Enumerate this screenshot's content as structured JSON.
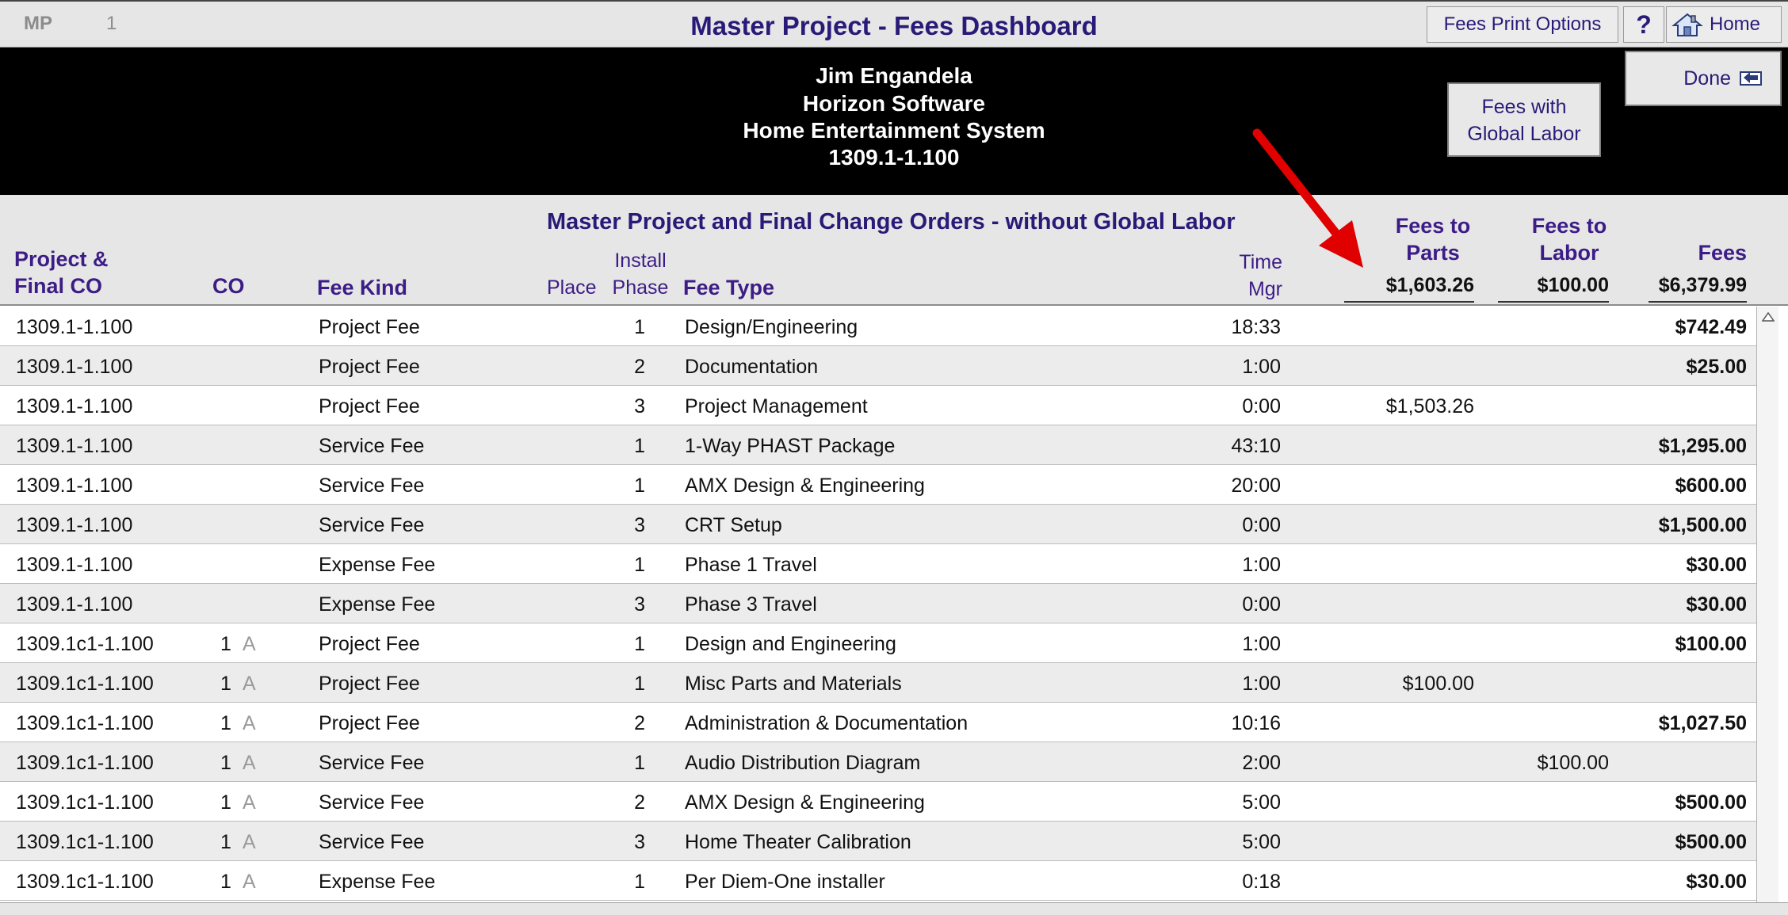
{
  "titlebar": {
    "mp": "MP",
    "num": "1",
    "title": "Master Project - Fees Dashboard",
    "print_options": "Fees Print Options",
    "help": "?",
    "home": "Home"
  },
  "header": {
    "line1": "Jim Engandela",
    "line2": "Horizon Software",
    "line3": "Home Entertainment System",
    "line4": "1309.1-1.100",
    "btn_global_1": "Fees with",
    "btn_global_2": "Global Labor",
    "done": "Done"
  },
  "colhead": {
    "subtitle": "Master Project and Final Change Orders - without Global Labor",
    "project_1": "Project &",
    "project_2": "Final CO",
    "co": "CO",
    "fee_kind": "Fee Kind",
    "place": "Place",
    "install": "Install",
    "phase": "Phase",
    "fee_type": "Fee Type",
    "time": "Time",
    "mgr": "Mgr",
    "fees_to_1": "Fees to",
    "parts": "Parts",
    "fees_to_2": "Fees to",
    "labor": "Labor",
    "fees": "Fees",
    "total_parts": "$1,603.26",
    "total_labor": "$100.00",
    "total_fees": "$6,379.99"
  },
  "rows": [
    {
      "project": "1309.1-1.100",
      "co": "",
      "co_a": "",
      "kind": "Project Fee",
      "phase": "1",
      "type": "Design/Engineering",
      "time": "18:33",
      "parts": "",
      "labor": "",
      "fees": "$742.49"
    },
    {
      "project": "1309.1-1.100",
      "co": "",
      "co_a": "",
      "kind": "Project Fee",
      "phase": "2",
      "type": "Documentation",
      "time": "1:00",
      "parts": "",
      "labor": "",
      "fees": "$25.00"
    },
    {
      "project": "1309.1-1.100",
      "co": "",
      "co_a": "",
      "kind": "Project Fee",
      "phase": "3",
      "type": "Project Management",
      "time": "0:00",
      "parts": "$1,503.26",
      "labor": "",
      "fees": ""
    },
    {
      "project": "1309.1-1.100",
      "co": "",
      "co_a": "",
      "kind": "Service Fee",
      "phase": "1",
      "type": "1-Way PHAST Package",
      "time": "43:10",
      "parts": "",
      "labor": "",
      "fees": "$1,295.00"
    },
    {
      "project": "1309.1-1.100",
      "co": "",
      "co_a": "",
      "kind": "Service Fee",
      "phase": "1",
      "type": "AMX Design & Engineering",
      "time": "20:00",
      "parts": "",
      "labor": "",
      "fees": "$600.00"
    },
    {
      "project": "1309.1-1.100",
      "co": "",
      "co_a": "",
      "kind": "Service Fee",
      "phase": "3",
      "type": "CRT Setup",
      "time": "0:00",
      "parts": "",
      "labor": "",
      "fees": "$1,500.00"
    },
    {
      "project": "1309.1-1.100",
      "co": "",
      "co_a": "",
      "kind": "Expense Fee",
      "phase": "1",
      "type": "Phase 1 Travel",
      "time": "1:00",
      "parts": "",
      "labor": "",
      "fees": "$30.00"
    },
    {
      "project": "1309.1-1.100",
      "co": "",
      "co_a": "",
      "kind": "Expense Fee",
      "phase": "3",
      "type": "Phase 3 Travel",
      "time": "0:00",
      "parts": "",
      "labor": "",
      "fees": "$30.00"
    },
    {
      "project": "1309.1c1-1.100",
      "co": "1",
      "co_a": "A",
      "kind": "Project Fee",
      "phase": "1",
      "type": "Design and Engineering",
      "time": "1:00",
      "parts": "",
      "labor": "",
      "fees": "$100.00"
    },
    {
      "project": "1309.1c1-1.100",
      "co": "1",
      "co_a": "A",
      "kind": "Project Fee",
      "phase": "1",
      "type": "Misc Parts and Materials",
      "time": "1:00",
      "parts": "$100.00",
      "labor": "",
      "fees": ""
    },
    {
      "project": "1309.1c1-1.100",
      "co": "1",
      "co_a": "A",
      "kind": "Project Fee",
      "phase": "2",
      "type": "Administration & Documentation",
      "time": "10:16",
      "parts": "",
      "labor": "",
      "fees": "$1,027.50"
    },
    {
      "project": "1309.1c1-1.100",
      "co": "1",
      "co_a": "A",
      "kind": "Service Fee",
      "phase": "1",
      "type": "Audio Distribution Diagram",
      "time": "2:00",
      "parts": "",
      "labor": "$100.00",
      "fees": ""
    },
    {
      "project": "1309.1c1-1.100",
      "co": "1",
      "co_a": "A",
      "kind": "Service Fee",
      "phase": "2",
      "type": "AMX Design & Engineering",
      "time": "5:00",
      "parts": "",
      "labor": "",
      "fees": "$500.00"
    },
    {
      "project": "1309.1c1-1.100",
      "co": "1",
      "co_a": "A",
      "kind": "Service Fee",
      "phase": "3",
      "type": "Home Theater Calibration",
      "time": "5:00",
      "parts": "",
      "labor": "",
      "fees": "$500.00"
    },
    {
      "project": "1309.1c1-1.100",
      "co": "1",
      "co_a": "A",
      "kind": "Expense Fee",
      "phase": "1",
      "type": "Per Diem-One installer",
      "time": "0:18",
      "parts": "",
      "labor": "",
      "fees": "$30.00"
    }
  ],
  "colors": {
    "accent": "#2a1a78",
    "header_purple": "#3c1c86",
    "arrow": "#e00000"
  },
  "icons": {
    "home": "home-icon",
    "done": "return-icon",
    "arrow": "red-arrow-annotation"
  }
}
